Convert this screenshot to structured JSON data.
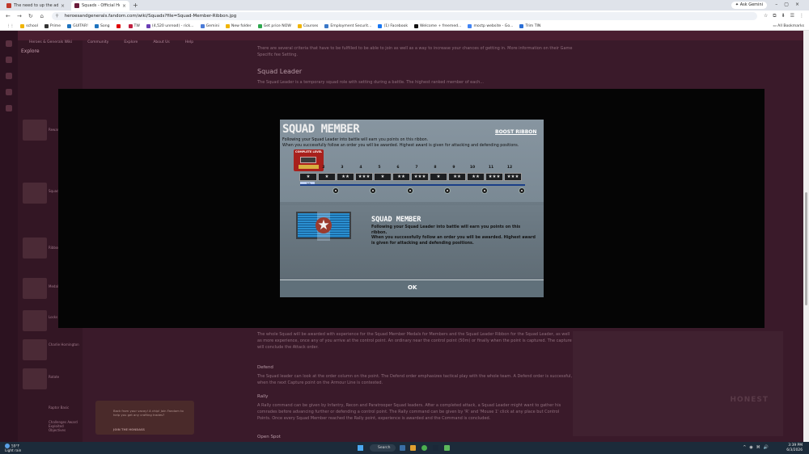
{
  "browser": {
    "tabs": [
      {
        "title": "The need to up the add theme!",
        "active": false,
        "color": "#c0392b"
      },
      {
        "title": "Squads - Official Heroes & Ge...",
        "active": true,
        "color": "#6a1b3a"
      }
    ],
    "ask_gemini": "Ask Gemini",
    "url": "heroesandgenerals.fandom.com/wiki/Squads?file=Squad-Member-Ribbon.jpg",
    "bookmarks": [
      {
        "label": "school",
        "color": "#f0b400"
      },
      {
        "label": "Prime",
        "color": "#333333"
      },
      {
        "label": "GUITAR!",
        "color": "#1e73be"
      },
      {
        "label": "Song",
        "color": "#1e73be"
      },
      {
        "label": "",
        "color": "#e00000"
      },
      {
        "label": "TW",
        "color": "#c02040"
      },
      {
        "label": "(4,520 unread) - rick...",
        "color": "#6a3fb5"
      },
      {
        "label": "Gemini",
        "color": "#4a7bd8"
      },
      {
        "label": "New folder",
        "color": "#f0b400"
      },
      {
        "label": "Get price NOW",
        "color": "#2fa84f"
      },
      {
        "label": "Courses",
        "color": "#f0b400"
      },
      {
        "label": "Employment Securit...",
        "color": "#3a78c8"
      },
      {
        "label": "(1) Facebook",
        "color": "#1877f2"
      },
      {
        "label": "Welcome + freemed...",
        "color": "#111111"
      },
      {
        "label": "moctp website - Go...",
        "color": "#4285f4"
      },
      {
        "label": "Trim TIN",
        "color": "#2b6fd6"
      }
    ],
    "all_bookmarks": "All Bookmarks"
  },
  "wiki": {
    "sidebar_title": "Explore",
    "header_items": [
      "Heroes & Generals Wiki",
      "Community",
      "Explore",
      "About Us",
      "Help"
    ],
    "heading": "Squad Leader",
    "text_top": "There are several criteria that have to be fulfilled to be able to join as well as a way to increase your chances of getting in. More information on their Game Specific fee Setting.",
    "text_mid": "The Squad Leader is a temporary squad role with setting during a battle. The highest ranked member of each...",
    "text_bottom": "The whole Squad will be awarded with experience for the Squad Member Medals for Members and the Squad Leader Ribbon for the Squad Leader, as well as more experience, once any of you arrive at the control point. An ordinary near the control point (50m) or finally when the point is captured. The capture will conclude the Attack order.",
    "defend_heading": "Defend",
    "defend_text": "The Squad leader can look at the order column on the point. The Defend order emphasizes tactical play with the whole team. A Defend order is successful, when the next Capture point on the Armour Line is contested.",
    "rally_heading": "Rally",
    "rally_text": "A Rally command can be given by Infantry, Recon and Paratrooper Squad leaders. After a completed attack, a Squad Leader might want to gather his comrades before advancing further or defending a control point. The Rally command can be given by 'R' and 'Mouse 1' click at any place but Control Points. Once every Squad Member reached the Rally point, experience is awarded and the Command is concluded.",
    "more_heading": "Open Spot",
    "sidebar_labels": [
      "Rewards",
      "",
      "Squad Leader",
      "Ribbons",
      "Medals",
      "Locks",
      "Charlie Hornington",
      "Rotate",
      "Raptor Basic",
      "Challenges Award Exploited Objectives"
    ],
    "popup_text": "Back from your vacay! A chip! Join Fandom to help you get any crafting trades?",
    "popup_button": "JOIN THE HONDASS",
    "right_logo": "HONEST"
  },
  "game": {
    "title": "SQUAD MEMBER",
    "boost_ribbon": "BOOST RIBBON",
    "description_line1": "Following your Squad Leader into battle will earn you points on this ribbon.",
    "description_line2": "When you successfully follow an order you will be awarded. Highest award is given for attacking and defending positions.",
    "complete_level": "COMPLETE LEVEL",
    "levels": [
      "2",
      "3",
      "4",
      "5",
      "6",
      "7",
      "8",
      "9",
      "10",
      "11",
      "12"
    ],
    "ribbon_slots": [
      "★",
      "★",
      "★★",
      "★★★",
      "★",
      "★★",
      "★★★",
      "★",
      "★★",
      "★★",
      "★★★",
      "★★★"
    ],
    "first_slot_progress": "5/5",
    "ribbon_title": "SQUAD MEMBER",
    "ribbon_desc_line1": "Following your Squad Leader into battle will earn you points on this ribbon.",
    "ribbon_desc_line2": "When you successfully follow an order you will be awarded. Highest award is given for attacking and defending positions.",
    "ok": "OK"
  },
  "taskbar": {
    "temperature": "59°F",
    "weather": "Light rain",
    "search": "Search",
    "time": "3:39 PM",
    "date": "6/3/2026"
  }
}
